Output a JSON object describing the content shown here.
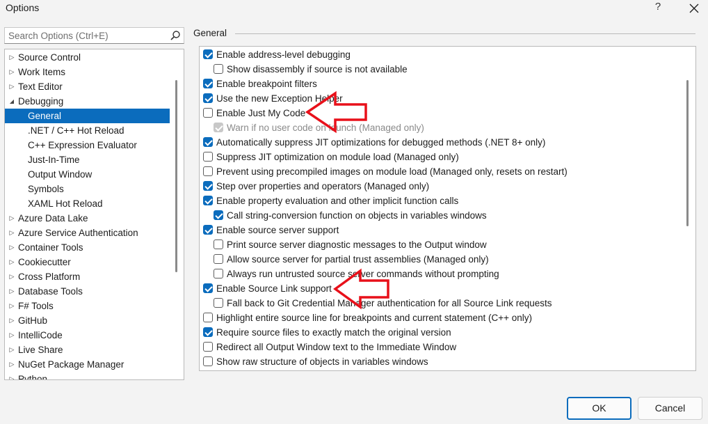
{
  "window": {
    "title": "Options",
    "help_label": "?"
  },
  "search": {
    "placeholder": "Search Options (Ctrl+E)"
  },
  "tree": {
    "items": [
      {
        "label": "Source Control",
        "level": 0,
        "expander": "collapsed"
      },
      {
        "label": "Work Items",
        "level": 0,
        "expander": "collapsed"
      },
      {
        "label": "Text Editor",
        "level": 0,
        "expander": "collapsed"
      },
      {
        "label": "Debugging",
        "level": 0,
        "expander": "expanded"
      },
      {
        "label": "General",
        "level": 1,
        "selected": true
      },
      {
        "label": ".NET / C++ Hot Reload",
        "level": 1
      },
      {
        "label": "C++ Expression Evaluator",
        "level": 1
      },
      {
        "label": "Just-In-Time",
        "level": 1
      },
      {
        "label": "Output Window",
        "level": 1
      },
      {
        "label": "Symbols",
        "level": 1
      },
      {
        "label": "XAML Hot Reload",
        "level": 1
      },
      {
        "label": "Azure Data Lake",
        "level": 0,
        "expander": "collapsed"
      },
      {
        "label": "Azure Service Authentication",
        "level": 0,
        "expander": "collapsed"
      },
      {
        "label": "Container Tools",
        "level": 0,
        "expander": "collapsed"
      },
      {
        "label": "Cookiecutter",
        "level": 0,
        "expander": "collapsed"
      },
      {
        "label": "Cross Platform",
        "level": 0,
        "expander": "collapsed"
      },
      {
        "label": "Database Tools",
        "level": 0,
        "expander": "collapsed"
      },
      {
        "label": "F# Tools",
        "level": 0,
        "expander": "collapsed"
      },
      {
        "label": "GitHub",
        "level": 0,
        "expander": "collapsed"
      },
      {
        "label": "IntelliCode",
        "level": 0,
        "expander": "collapsed"
      },
      {
        "label": "Live Share",
        "level": 0,
        "expander": "collapsed"
      },
      {
        "label": "NuGet Package Manager",
        "level": 0,
        "expander": "collapsed"
      },
      {
        "label": "Python",
        "level": 0,
        "expander": "collapsed"
      }
    ]
  },
  "section": {
    "title": "General"
  },
  "options": [
    {
      "label": "Enable address-level debugging",
      "checked": true,
      "indent": 0
    },
    {
      "label": "Show disassembly if source is not available",
      "checked": false,
      "indent": 1
    },
    {
      "label": "Enable breakpoint filters",
      "checked": true,
      "indent": 0
    },
    {
      "label": "Use the new Exception Helper",
      "checked": true,
      "indent": 0
    },
    {
      "label": "Enable Just My Code",
      "checked": false,
      "indent": 0
    },
    {
      "label": "Warn if no user code on launch (Managed only)",
      "checked": true,
      "indent": 1,
      "disabled": true
    },
    {
      "label": "Automatically suppress JIT optimizations for debugged methods (.NET 8+ only)",
      "checked": true,
      "indent": 0
    },
    {
      "label": "Suppress JIT optimization on module load (Managed only)",
      "checked": false,
      "indent": 0
    },
    {
      "label": "Prevent using precompiled images on module load (Managed only, resets on restart)",
      "checked": false,
      "indent": 0
    },
    {
      "label": "Step over properties and operators (Managed only)",
      "checked": true,
      "indent": 0
    },
    {
      "label": "Enable property evaluation and other implicit function calls",
      "checked": true,
      "indent": 0
    },
    {
      "label": "Call string-conversion function on objects in variables windows",
      "checked": true,
      "indent": 1
    },
    {
      "label": "Enable source server support",
      "checked": true,
      "indent": 0
    },
    {
      "label": "Print source server diagnostic messages to the Output window",
      "checked": false,
      "indent": 1
    },
    {
      "label": "Allow source server for partial trust assemblies (Managed only)",
      "checked": false,
      "indent": 1
    },
    {
      "label": "Always run untrusted source server commands without prompting",
      "checked": false,
      "indent": 1
    },
    {
      "label": "Enable Source Link support",
      "checked": true,
      "indent": 0
    },
    {
      "label": "Fall back to Git Credential Manager authentication for all Source Link requests",
      "checked": false,
      "indent": 1
    },
    {
      "label": "Highlight entire source line for breakpoints and current statement (C++ only)",
      "checked": false,
      "indent": 0
    },
    {
      "label": "Require source files to exactly match the original version",
      "checked": true,
      "indent": 0
    },
    {
      "label": "Redirect all Output Window text to the Immediate Window",
      "checked": false,
      "indent": 0
    },
    {
      "label": "Show raw structure of objects in variables windows",
      "checked": false,
      "indent": 0
    }
  ],
  "annotations": {
    "arrow_color": "#e8101a",
    "arrow_targets": [
      "Enable Just My Code",
      "Enable Source Link support"
    ]
  },
  "buttons": {
    "ok": "OK",
    "cancel": "Cancel"
  },
  "colors": {
    "accent": "#0b6cbd",
    "background": "#f3f3f3"
  }
}
